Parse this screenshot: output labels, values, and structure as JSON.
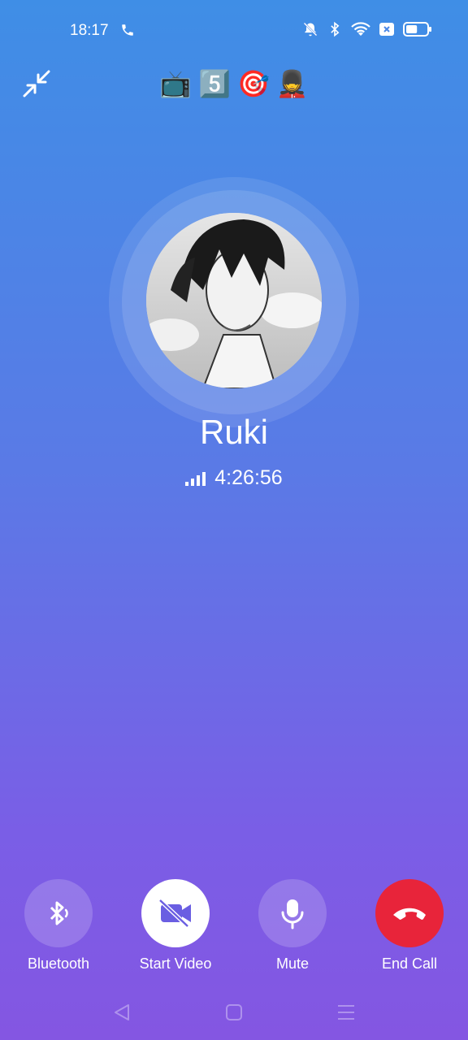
{
  "status_bar": {
    "time": "18:17",
    "icons": [
      "phone-call-icon",
      "mute-notifications-icon",
      "bluetooth-icon",
      "wifi-icon",
      "sim-x-icon",
      "battery-icon"
    ],
    "battery_level": 0.55
  },
  "header": {
    "minimize_icon": "minimize-icon",
    "emojis": [
      "📺",
      "5️⃣",
      "🎯",
      "💂"
    ]
  },
  "caller": {
    "name": "Ruki",
    "duration": "4:26:56",
    "signal_bars": 4
  },
  "controls": [
    {
      "id": "bluetooth",
      "label": "Bluetooth",
      "icon": "bluetooth-audio-icon"
    },
    {
      "id": "video",
      "label": "Start Video",
      "icon": "video-off-icon"
    },
    {
      "id": "mute",
      "label": "Mute",
      "icon": "microphone-icon"
    },
    {
      "id": "end",
      "label": "End Call",
      "icon": "hang-up-icon",
      "color": "#e8243a"
    }
  ],
  "navigation": [
    "back-icon",
    "home-icon",
    "recents-icon"
  ]
}
